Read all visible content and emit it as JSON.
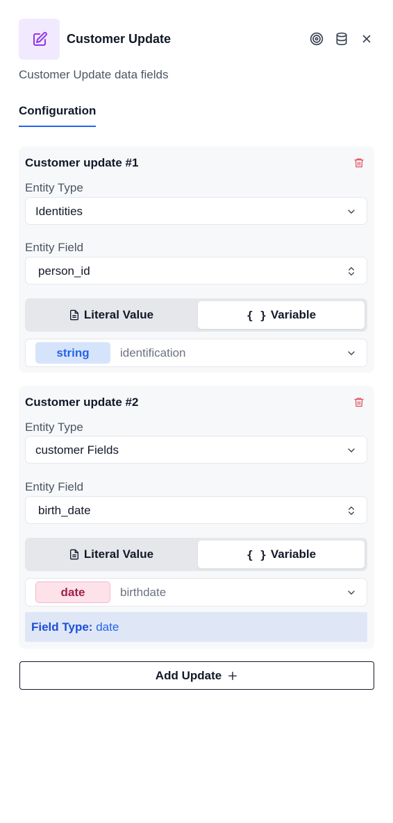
{
  "header": {
    "title": "Customer Update",
    "subtitle": "Customer Update data fields",
    "actions": [
      "target-icon",
      "database-icon",
      "close-icon"
    ]
  },
  "tabs": [
    {
      "label": "Configuration",
      "active": true
    }
  ],
  "updates": [
    {
      "title": "Customer update #1",
      "entity_type_label": "Entity Type",
      "entity_type_value": "Identities",
      "entity_field_label": "Entity Field",
      "entity_field_value": "person_id",
      "toggle": {
        "literal": "Literal Value",
        "variable_brace": "{ }",
        "variable": "Variable",
        "selected": "Variable"
      },
      "variable": {
        "type": "string",
        "name": "identification"
      }
    },
    {
      "title": "Customer update #2",
      "entity_type_label": "Entity Type",
      "entity_type_value": "customer Fields",
      "entity_field_label": "Entity Field",
      "entity_field_value": "birth_date",
      "toggle": {
        "literal": "Literal Value",
        "variable_brace": "{ }",
        "variable": "Variable",
        "selected": "Variable"
      },
      "variable": {
        "type": "date",
        "name": "birthdate"
      },
      "field_type": {
        "label": "Field Type:",
        "value": "date"
      }
    }
  ],
  "add_update": {
    "label": "Add Update",
    "icon": "plus-icon"
  },
  "colors": {
    "accent": "#2563eb",
    "danger": "#e0525a",
    "icon_bg": "#f1e9fe",
    "icon_fg": "#9333ea"
  }
}
